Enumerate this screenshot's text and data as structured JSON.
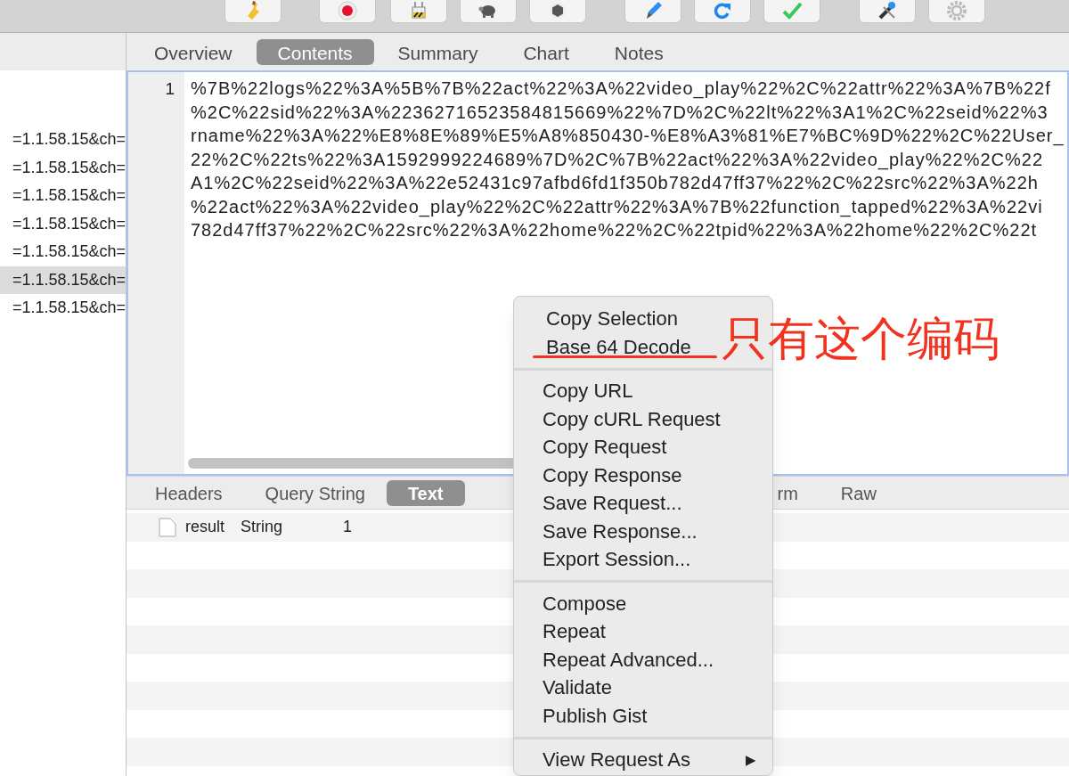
{
  "sidebar": {
    "rows": [
      {
        "text": "=1.1.58.15&ch=",
        "selected": false
      },
      {
        "text": "=1.1.58.15&ch=",
        "selected": false
      },
      {
        "text": "=1.1.58.15&ch=",
        "selected": false
      },
      {
        "text": "=1.1.58.15&ch=",
        "selected": false
      },
      {
        "text": "=1.1.58.15&ch=",
        "selected": false
      },
      {
        "text": "=1.1.58.15&ch=",
        "selected": true
      },
      {
        "text": "=1.1.58.15&ch=",
        "selected": false
      }
    ]
  },
  "tabs": [
    {
      "label": "Overview",
      "selected": false
    },
    {
      "label": "Contents",
      "selected": true
    },
    {
      "label": "Summary",
      "selected": false
    },
    {
      "label": "Chart",
      "selected": false
    },
    {
      "label": "Notes",
      "selected": false
    }
  ],
  "editor": {
    "line_number": "1",
    "lines": [
      "%7B%22logs%22%3A%5B%7B%22act%22%3A%22video_play%22%2C%22attr%22%3A%7B%22f",
      "%2C%22sid%22%3A%22362716523584815669%22%7D%2C%22lt%22%3A1%2C%22seid%22%3",
      "rname%22%3A%22%E8%8E%89%E5%A8%850430-%E8%A3%81%E7%BC%9D%22%2C%22User_",
      "22%2C%22ts%22%3A1592999224689%7D%2C%7B%22act%22%3A%22video_play%22%2C%22",
      "A1%2C%22seid%22%3A%22e52431c97afbd6fd1f350b782d47ff37%22%2C%22src%22%3A%22h",
      "%22act%22%3A%22video_play%22%2C%22attr%22%3A%7B%22function_tapped%22%3A%22vi",
      "782d47ff37%22%2C%22src%22%3A%22home%22%2C%22tpid%22%3A%22home%22%2C%22t"
    ]
  },
  "detail_tabs": [
    {
      "label": "Headers",
      "selected": false
    },
    {
      "label": "Query String",
      "selected": false
    },
    {
      "label": "Text",
      "selected": true
    },
    {
      "label": "rm",
      "selected": false
    },
    {
      "label": "Raw",
      "selected": false
    }
  ],
  "table": {
    "rows": [
      {
        "name": "result",
        "type": "String",
        "value": "1"
      }
    ]
  },
  "context_menu": {
    "groups": [
      [
        {
          "label": "Copy Selection"
        },
        {
          "label": "Base 64 Decode"
        }
      ],
      [
        {
          "label": "Copy URL"
        },
        {
          "label": "Copy cURL Request"
        },
        {
          "label": "Copy Request"
        },
        {
          "label": "Copy Response"
        },
        {
          "label": "Save Request..."
        },
        {
          "label": "Save Response..."
        },
        {
          "label": "Export Session..."
        }
      ],
      [
        {
          "label": "Compose"
        },
        {
          "label": "Repeat"
        },
        {
          "label": "Repeat Advanced..."
        },
        {
          "label": "Validate"
        },
        {
          "label": "Publish Gist"
        }
      ],
      [
        {
          "label": "View Request As",
          "submenu_arrow": "▶"
        }
      ]
    ]
  },
  "annotation": {
    "text": "只有这个编码"
  }
}
